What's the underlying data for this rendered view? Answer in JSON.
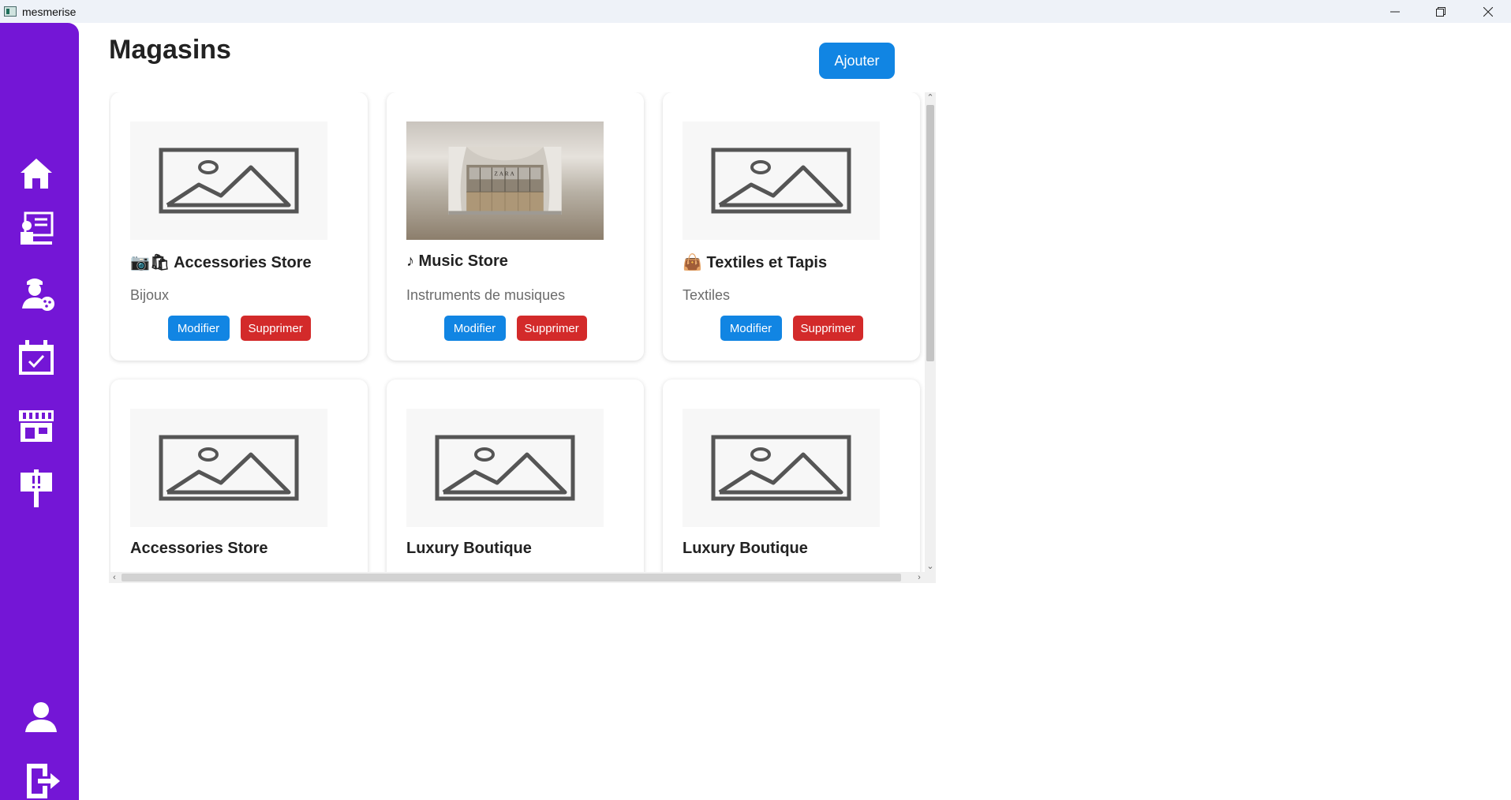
{
  "window": {
    "title": "mesmerise",
    "controls": [
      "minimize-icon",
      "restore-icon",
      "close-icon"
    ]
  },
  "sidebar": {
    "color": "#7416d6",
    "items": [
      {
        "icon": "home-icon"
      },
      {
        "icon": "presentation-icon"
      },
      {
        "icon": "artist-palette-icon"
      },
      {
        "icon": "calendar-check-icon"
      },
      {
        "icon": "store-icon"
      },
      {
        "icon": "signpost-icon"
      }
    ],
    "bottom_items": [
      {
        "icon": "user-icon"
      },
      {
        "icon": "logout-icon"
      }
    ]
  },
  "header": {
    "title": "Magasins",
    "add_label": "Ajouter"
  },
  "cards": [
    {
      "title": "📷🛍 Accessories Store",
      "category": "Bijoux",
      "image": "placeholder-image-icon",
      "edit_label": "Modifier",
      "delete_label": "Supprimer"
    },
    {
      "title": "♪ Music Store",
      "category": "Instruments de musiques",
      "image": "store-photo",
      "edit_label": "Modifier",
      "delete_label": "Supprimer"
    },
    {
      "title": "👜 Textiles et Tapis",
      "category": "Textiles",
      "image": "placeholder-image-icon",
      "edit_label": "Modifier",
      "delete_label": "Supprimer"
    },
    {
      "title": "Accessories Store",
      "category": "",
      "image": "placeholder-image-icon"
    },
    {
      "title": "Luxury Boutique",
      "category": "",
      "image": "placeholder-image-icon"
    },
    {
      "title": "Luxury Boutique",
      "category": "",
      "image": "placeholder-image-icon"
    }
  ],
  "photo_sign": "ZARA",
  "colors": {
    "primary": "#1185e3",
    "danger": "#d32a2a",
    "sidebar": "#7416d6"
  }
}
